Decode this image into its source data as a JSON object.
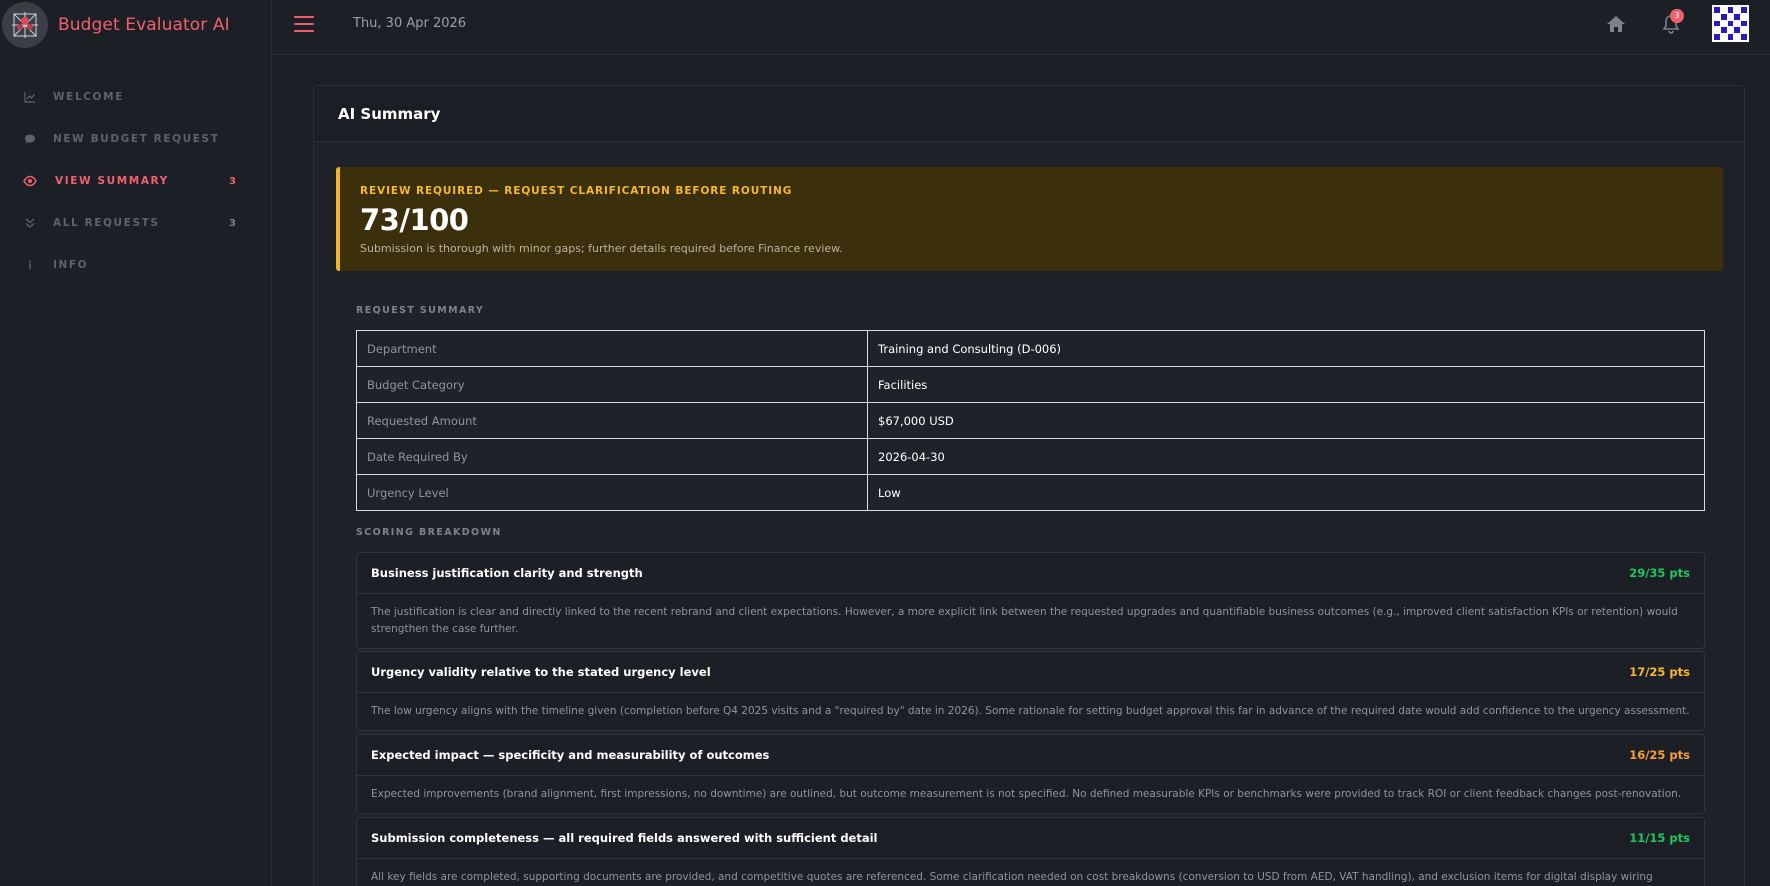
{
  "app": {
    "title": "Budget Evaluator AI"
  },
  "sidebar": {
    "items": [
      {
        "label": "WELCOME",
        "icon": "chart-line-icon",
        "badge": ""
      },
      {
        "label": "NEW BUDGET REQUEST",
        "icon": "chat-bubble-icon",
        "badge": ""
      },
      {
        "label": "VIEW SUMMARY",
        "icon": "eye-icon",
        "badge": "3",
        "active": true
      },
      {
        "label": "ALL REQUESTS",
        "icon": "double-chevron-down-icon",
        "badge": "3"
      },
      {
        "label": "INFO",
        "icon": "info-icon",
        "badge": ""
      }
    ]
  },
  "topbar": {
    "date": "Thu, 30 Apr 2026",
    "notification_count": "3"
  },
  "main": {
    "title": "AI Summary",
    "alert": {
      "label": "REVIEW REQUIRED — REQUEST CLARIFICATION BEFORE ROUTING",
      "score": "73/100",
      "text": "Submission is thorough with minor gaps; further details required before Finance review."
    },
    "request_summary": {
      "heading": "REQUEST SUMMARY",
      "rows": [
        {
          "key": "Department",
          "value": "Training and Consulting (D-006)"
        },
        {
          "key": "Budget Category",
          "value": "Facilities"
        },
        {
          "key": "Requested Amount",
          "value": "$67,000 USD"
        },
        {
          "key": "Date Required By",
          "value": "2026-04-30"
        },
        {
          "key": "Urgency Level",
          "value": "Low"
        }
      ]
    },
    "scoring": {
      "heading": "SCORING BREAKDOWN",
      "items": [
        {
          "name": "Business justification clarity and strength",
          "points": "29/35 pts",
          "color": "#22c55e",
          "text": "The justification is clear and directly linked to the recent rebrand and client expectations. However, a more explicit link between the requested upgrades and quantifiable business outcomes (e.g., improved client satisfaction KPIs or retention) would strengthen the case further."
        },
        {
          "name": "Urgency validity relative to the stated urgency level",
          "points": "17/25 pts",
          "color": "#f5b82e",
          "text": "The low urgency aligns with the timeline given (completion before Q4 2025 visits and a \"required by\" date in 2026). Some rationale for setting budget approval this far in advance of the required date would add confidence to the urgency assessment."
        },
        {
          "name": "Expected impact — specificity and measurability of outcomes",
          "points": "16/25 pts",
          "color": "#f59e3b",
          "text": "Expected improvements (brand alignment, first impressions, no downtime) are outlined, but outcome measurement is not specified. No defined measurable KPIs or benchmarks were provided to track ROI or client feedback changes post-renovation."
        },
        {
          "name": "Submission completeness — all required fields answered with sufficient detail",
          "points": "11/15 pts",
          "color": "#22c55e",
          "text": "All key fields are completed, supporting documents are provided, and competitive quotes are referenced. Some clarification needed on cost breakdowns (conversion to USD from AED, VAT handling), and exclusion items for digital display wiring should be addressed in"
        }
      ]
    }
  }
}
